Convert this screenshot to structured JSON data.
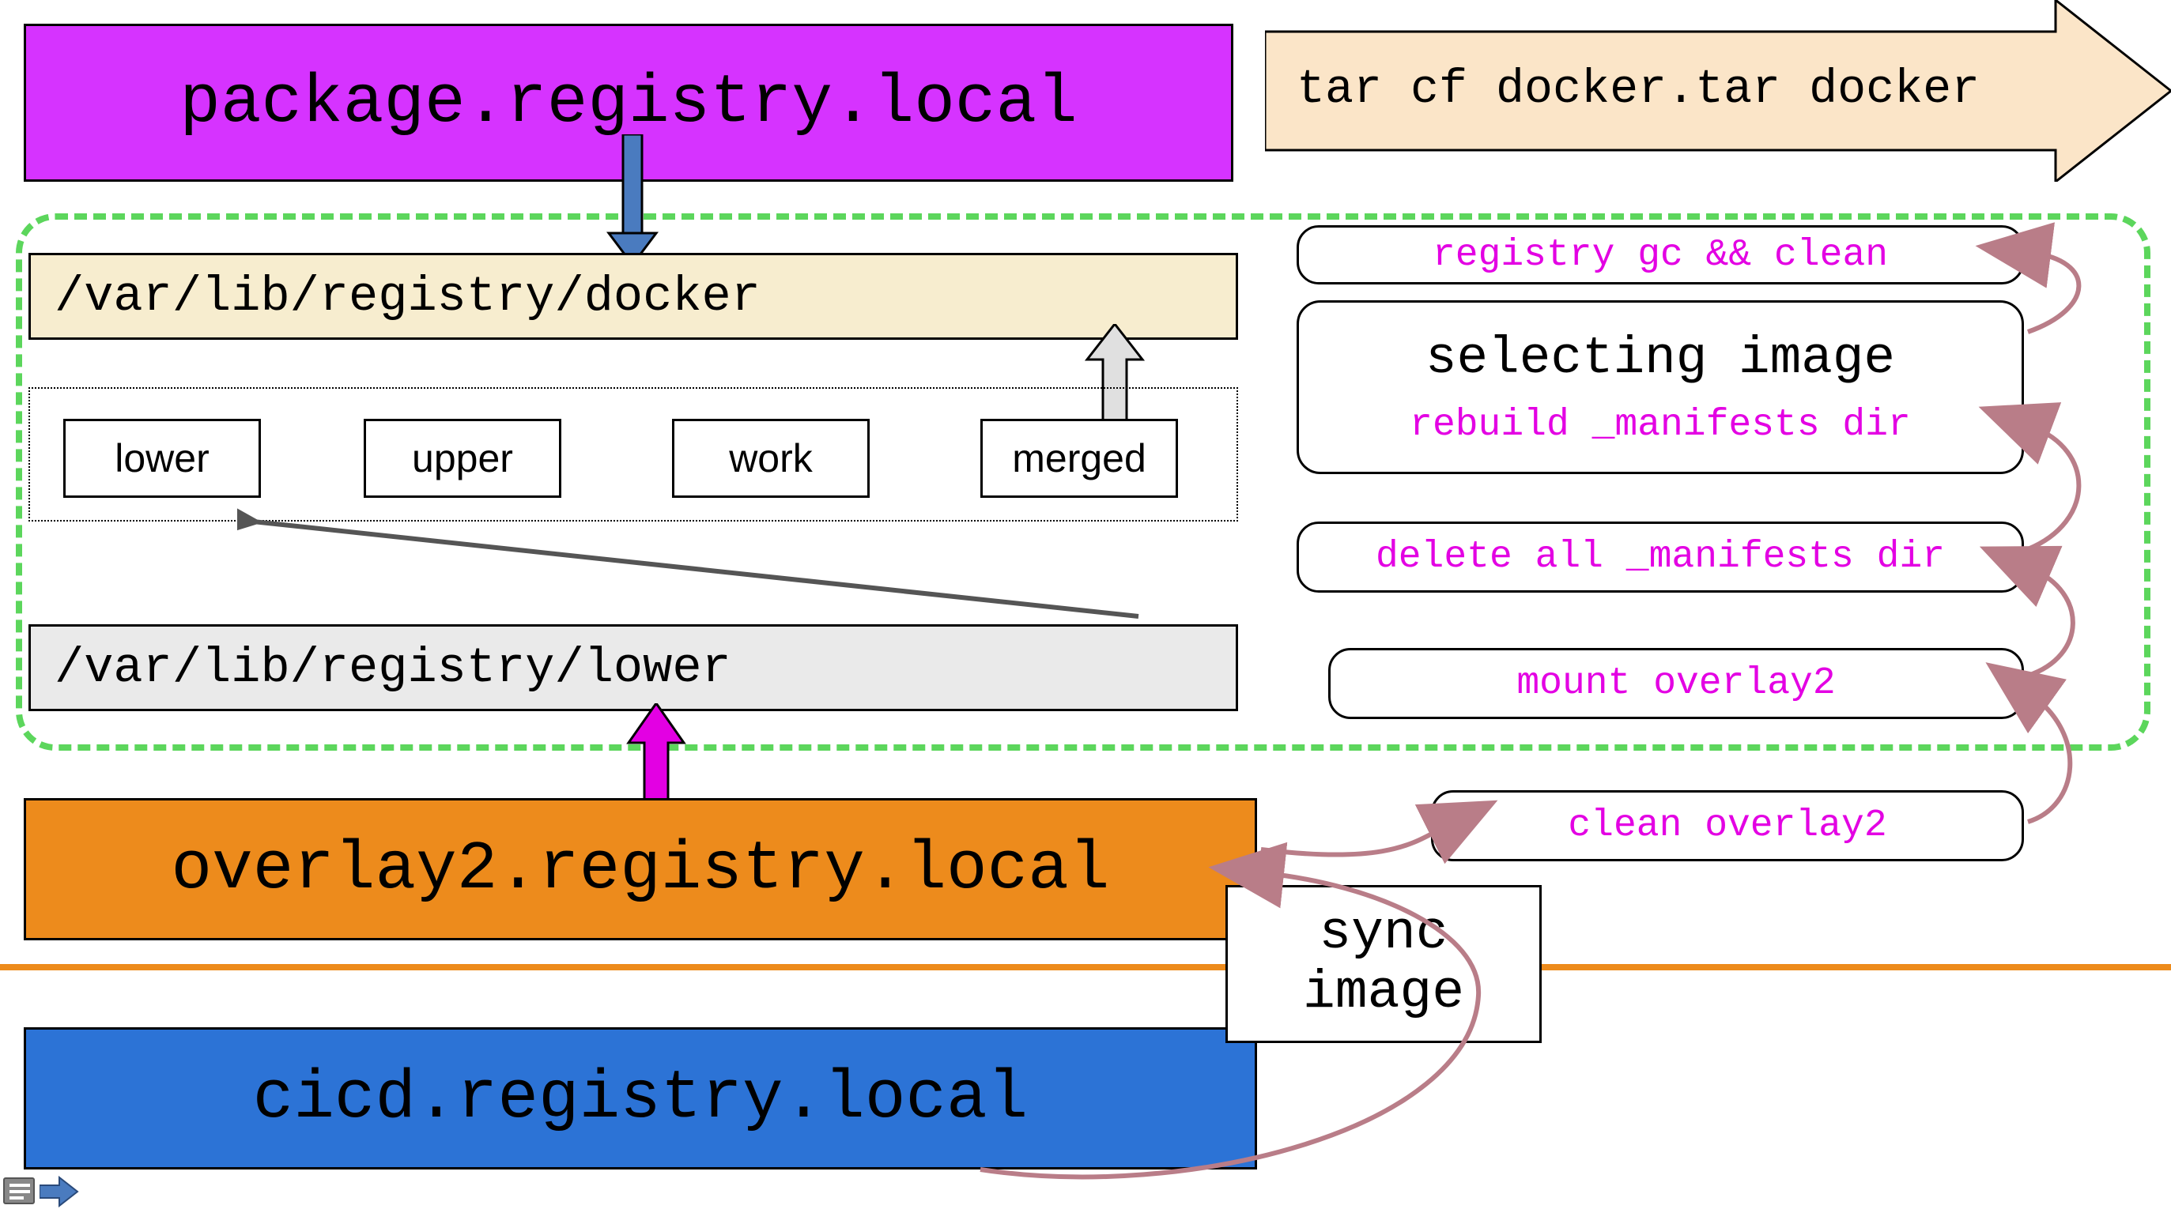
{
  "colors": {
    "magenta": "#d633ff",
    "magenta_text": "#e300e3",
    "orange": "#ed8b1c",
    "blue": "#2c73d6",
    "steel_blue": "#4a7bbf",
    "cream": "#f7edcf",
    "cream_arrow": "#fbe5c8",
    "grey_light": "#eaeaea",
    "grey_arrow": "#e0e0e0",
    "green_dash": "#5cd65c",
    "curve": "#b97d88"
  },
  "top": {
    "package": "package.registry.local",
    "tar": "tar cf docker.tar docker"
  },
  "paths": {
    "docker": "/var/lib/registry/docker",
    "lower": "/var/lib/registry/lower"
  },
  "overlay_dirs": {
    "lower": "lower",
    "upper": "upper",
    "work": "work",
    "merged": "merged"
  },
  "registries": {
    "overlay2": "overlay2.registry.local",
    "cicd": "cicd.registry.local"
  },
  "steps": {
    "gc": "registry gc && clean",
    "selecting_title": "selecting image",
    "rebuild": "rebuild _manifests dir",
    "delete": "delete all _manifests dir",
    "mount": "mount overlay2",
    "clean": "clean overlay2"
  },
  "sync": {
    "line1": "sync",
    "line2": "image"
  }
}
